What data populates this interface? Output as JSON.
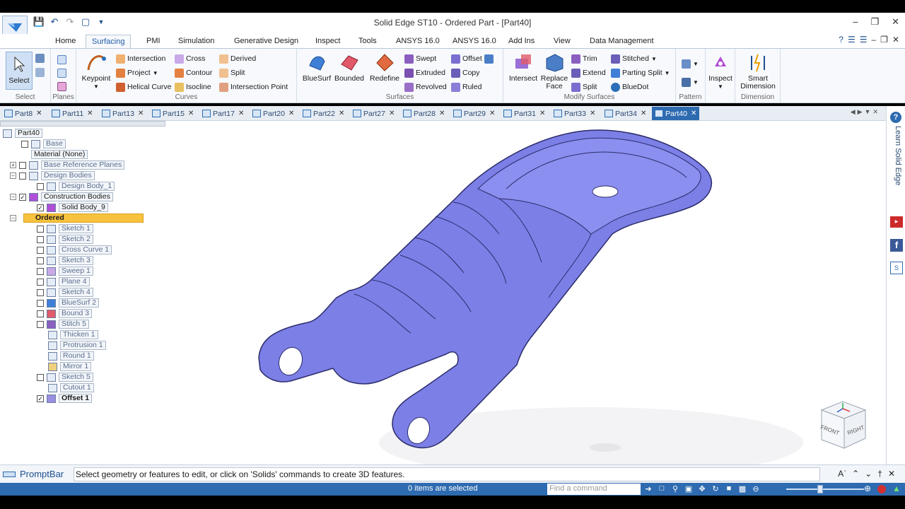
{
  "app": {
    "title": "Solid Edge ST10 - Ordered Part - [Part40]"
  },
  "ribbon_tabs": [
    "Home",
    "Surfacing",
    "PMI",
    "Simulation",
    "Generative Design",
    "Inspect",
    "Tools",
    "ANSYS 16.0",
    "ANSYS 16.0",
    "Add Ins",
    "View",
    "Data Management"
  ],
  "active_ribbon_tab": "Surfacing",
  "ribbon": {
    "select": {
      "label": "Select",
      "group": "Select"
    },
    "planes": {
      "group": "Planes"
    },
    "curves": {
      "keypoint": "Keypoint",
      "intersection": "Intersection",
      "project": "Project",
      "helical_curve": "Helical Curve",
      "cross": "Cross",
      "contour": "Contour",
      "isocline": "Isocline",
      "derived": "Derived",
      "split": "Split",
      "intersection_point": "Intersection Point",
      "group": "Curves"
    },
    "surfaces": {
      "bluesurf": "BlueSurf",
      "bounded": "Bounded",
      "redefine": "Redefine",
      "swept": "Swept",
      "extruded": "Extruded",
      "revolved": "Revolved",
      "offset": "Offset",
      "copy": "Copy",
      "ruled": "Ruled",
      "group": "Surfaces"
    },
    "modify": {
      "intersect": "Intersect",
      "replace_face_1": "Replace",
      "replace_face_2": "Face",
      "trim": "Trim",
      "extend": "Extend",
      "split": "Split",
      "stitched": "Stitched",
      "parting_split": "Parting Split",
      "bluedot": "BlueDot",
      "group": "Modify Surfaces"
    },
    "pattern": {
      "group": "Pattern"
    },
    "inspect": {
      "label": "Inspect"
    },
    "dimension": {
      "smart_1": "Smart",
      "smart_2": "Dimension",
      "group": "Dimension"
    }
  },
  "doc_tabs": [
    "Part8",
    "Part11",
    "Part13",
    "Part15",
    "Part17",
    "Part20",
    "Part22",
    "Part27",
    "Part28",
    "Part29",
    "Part31",
    "Part33",
    "Part34",
    "Part40"
  ],
  "active_doc_tab": "Part40",
  "tree": {
    "root": "Part40",
    "items": [
      {
        "label": "Base",
        "dim": true
      },
      {
        "label": "Material (None)"
      },
      {
        "label": "Base Reference Planes",
        "dim": true
      },
      {
        "label": "Design Bodies",
        "dim": true
      },
      {
        "label": "Design Body_1",
        "dim": true
      },
      {
        "label": "Construction Bodies"
      },
      {
        "label": "Solid Body_9"
      },
      {
        "label": "Ordered"
      },
      {
        "label": "Sketch 1",
        "dim": true
      },
      {
        "label": "Sketch 2",
        "dim": true
      },
      {
        "label": "Cross Curve 1",
        "dim": true
      },
      {
        "label": "Sketch 3",
        "dim": true
      },
      {
        "label": "Sweep 1",
        "dim": true
      },
      {
        "label": "Plane 4",
        "dim": true
      },
      {
        "label": "Sketch 4",
        "dim": true
      },
      {
        "label": "BlueSurf 2",
        "dim": true
      },
      {
        "label": "Bound 3",
        "dim": true
      },
      {
        "label": "Stitch 5",
        "dim": true
      },
      {
        "label": "Thicken 1",
        "dim": true
      },
      {
        "label": "Protrusion 1",
        "dim": true
      },
      {
        "label": "Round 1",
        "dim": true
      },
      {
        "label": "Mirror 1",
        "dim": true
      },
      {
        "label": "Sketch 5",
        "dim": true
      },
      {
        "label": "Cutout 1",
        "dim": true
      },
      {
        "label": "Offset 1"
      }
    ]
  },
  "viewcube": {
    "front": "FRONT",
    "right": "RIGHT"
  },
  "right_pane": {
    "learn": "Learn Solid Edge"
  },
  "promptbar": {
    "label": "PromptBar",
    "text": "Select geometry or features to edit, or click on 'Solids' commands to create 3D features."
  },
  "status": {
    "selection": "0 items are selected",
    "find_placeholder": "Find a command"
  },
  "colors": {
    "part": "#7b7fe6",
    "accent": "#2e6bb0",
    "ordered_highlight": "#f7c23d"
  }
}
